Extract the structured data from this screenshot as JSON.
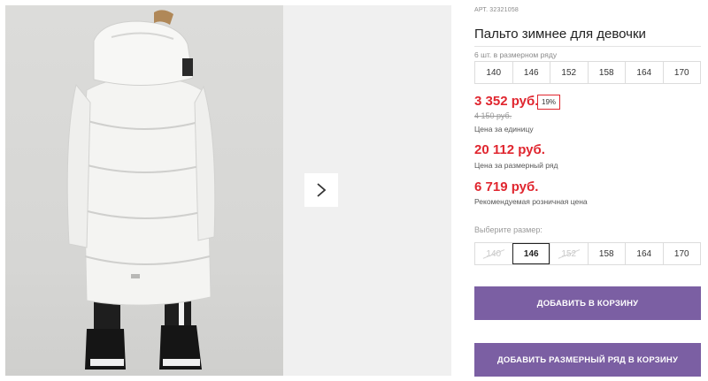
{
  "gallery": {
    "next_icon": "chevron-right-icon"
  },
  "product": {
    "article_label": "АРТ.",
    "article_value": "32321058",
    "title": "Пальто зимнее для девочки"
  },
  "size_row": {
    "caption": "6 шт. в размерном ряду",
    "sizes": [
      "140",
      "146",
      "152",
      "158",
      "164",
      "170"
    ]
  },
  "prices": {
    "unit_price": "3 352 руб.",
    "discount": "19%",
    "old_price": "4 150 руб.",
    "unit_caption": "Цена за единицу",
    "row_price": "20 112 руб.",
    "row_caption": "Цена за размерный ряд",
    "retail_price": "6 719 руб.",
    "retail_caption": "Рекомендуемая розничная цена"
  },
  "size_select": {
    "label": "Выберите размер:",
    "sizes": [
      "140",
      "146",
      "152",
      "158",
      "164",
      "170"
    ],
    "selected": "146",
    "disabled": [
      "140",
      "152"
    ]
  },
  "actions": {
    "add_to_cart": "ДОБАВИТЬ В КОРЗИНУ",
    "add_row_to_cart": "ДОБАВИТЬ РАЗМЕРНЫЙ РЯД В КОРЗИНУ"
  },
  "colors": {
    "accent_purple": "#7b5fa3",
    "price_red": "#e0262f"
  }
}
